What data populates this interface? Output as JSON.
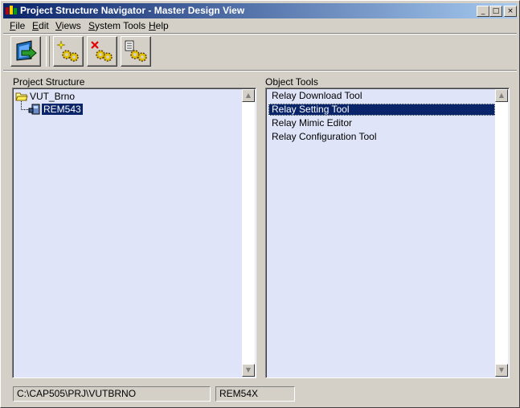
{
  "window": {
    "title": "Project Structure Navigator - Master Design View",
    "controls": {
      "minimize": "_",
      "maximize": "□",
      "close": "×"
    }
  },
  "menubar": [
    {
      "label": "File",
      "accel": "F",
      "rest": "ile"
    },
    {
      "label": "Edit",
      "accel": "E",
      "rest": "dit"
    },
    {
      "label": "Views",
      "accel": "V",
      "rest": "iews"
    },
    {
      "label": "System Tools",
      "accel": "S",
      "rest": "ystem Tools"
    },
    {
      "label": "Help",
      "accel": "H",
      "rest": "elp"
    }
  ],
  "toolbar": {
    "buttons": [
      {
        "icon": "exit-door-icon"
      },
      {
        "icon": "new-object-gears-icon"
      },
      {
        "icon": "delete-object-gears-icon"
      },
      {
        "icon": "object-properties-gears-icon"
      }
    ]
  },
  "project_structure": {
    "label": "Project Structure",
    "root": {
      "label": "VUT_Brno",
      "icon": "folder-open-icon"
    },
    "child": {
      "label": "REM543",
      "icon": "relay-device-icon",
      "selected": true
    }
  },
  "object_tools": {
    "label": "Object Tools",
    "items": [
      {
        "label": "Relay Download Tool",
        "selected": false
      },
      {
        "label": "Relay Setting Tool",
        "selected": true
      },
      {
        "label": "Relay Mimic Editor",
        "selected": false
      },
      {
        "label": "Relay Configuration Tool",
        "selected": false
      }
    ]
  },
  "statusbar": {
    "path": "C:\\CAP505\\PRJ\\VUTBRNO",
    "device": "REM54X"
  },
  "colors": {
    "title_start": "#0a246a",
    "title_end": "#a6caf0",
    "list_background": "#dfe4f8",
    "selection": "#0a246a"
  }
}
